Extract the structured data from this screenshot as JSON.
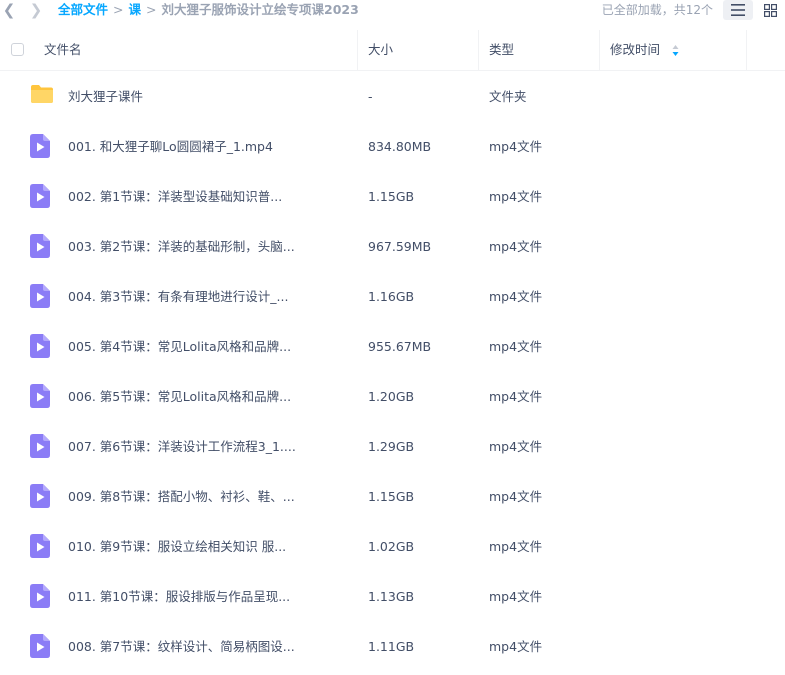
{
  "nav": {
    "back_icon": "chevron-left-icon",
    "forward_icon": "chevron-right-icon"
  },
  "breadcrumb": {
    "items": [
      "全部文件",
      "课"
    ],
    "separator": ">",
    "current": "刘大狸子服饰设计立绘专项课2023"
  },
  "status": "已全部加载，共12个",
  "view_toggle": {
    "list_icon": "list-view-icon",
    "grid_icon": "grid-view-icon"
  },
  "header": {
    "name": "文件名",
    "size": "大小",
    "type": "类型",
    "modified": "修改时间"
  },
  "colors": {
    "accent": "#06a7ff",
    "folder": "#ffc53d",
    "video": "#8b7cf6",
    "text": "#424e67",
    "muted": "#9aa3b3"
  },
  "files": [
    {
      "icon": "folder-icon",
      "name": "刘大狸子课件",
      "size": "-",
      "type": "文件夹"
    },
    {
      "icon": "video-file-icon",
      "name": "001. 和大狸子聊Lo圆圆裙子_1.mp4",
      "size": "834.80MB",
      "type": "mp4文件"
    },
    {
      "icon": "video-file-icon",
      "name": "002. 第1节课：洋装型设基础知识普...",
      "size": "1.15GB",
      "type": "mp4文件"
    },
    {
      "icon": "video-file-icon",
      "name": "003. 第2节课：洋装的基础形制，头脑...",
      "size": "967.59MB",
      "type": "mp4文件"
    },
    {
      "icon": "video-file-icon",
      "name": "004. 第3节课：有条有理地进行设计_...",
      "size": "1.16GB",
      "type": "mp4文件"
    },
    {
      "icon": "video-file-icon",
      "name": "005. 第4节课：常见Lolita风格和品牌...",
      "size": "955.67MB",
      "type": "mp4文件"
    },
    {
      "icon": "video-file-icon",
      "name": "006. 第5节课：常见Lolita风格和品牌...",
      "size": "1.20GB",
      "type": "mp4文件"
    },
    {
      "icon": "video-file-icon",
      "name": "007. 第6节课：洋装设计工作流程3_1....",
      "size": "1.29GB",
      "type": "mp4文件"
    },
    {
      "icon": "video-file-icon",
      "name": "009. 第8节课：搭配小物、衬衫、鞋、...",
      "size": "1.15GB",
      "type": "mp4文件"
    },
    {
      "icon": "video-file-icon",
      "name": "010. 第9节课：服设立绘相关知识 服...",
      "size": "1.02GB",
      "type": "mp4文件"
    },
    {
      "icon": "video-file-icon",
      "name": "011. 第10节课：服设排版与作品呈现...",
      "size": "1.13GB",
      "type": "mp4文件"
    },
    {
      "icon": "video-file-icon",
      "name": "008. 第7节课：纹样设计、简易柄图设...",
      "size": "1.11GB",
      "type": "mp4文件"
    }
  ]
}
